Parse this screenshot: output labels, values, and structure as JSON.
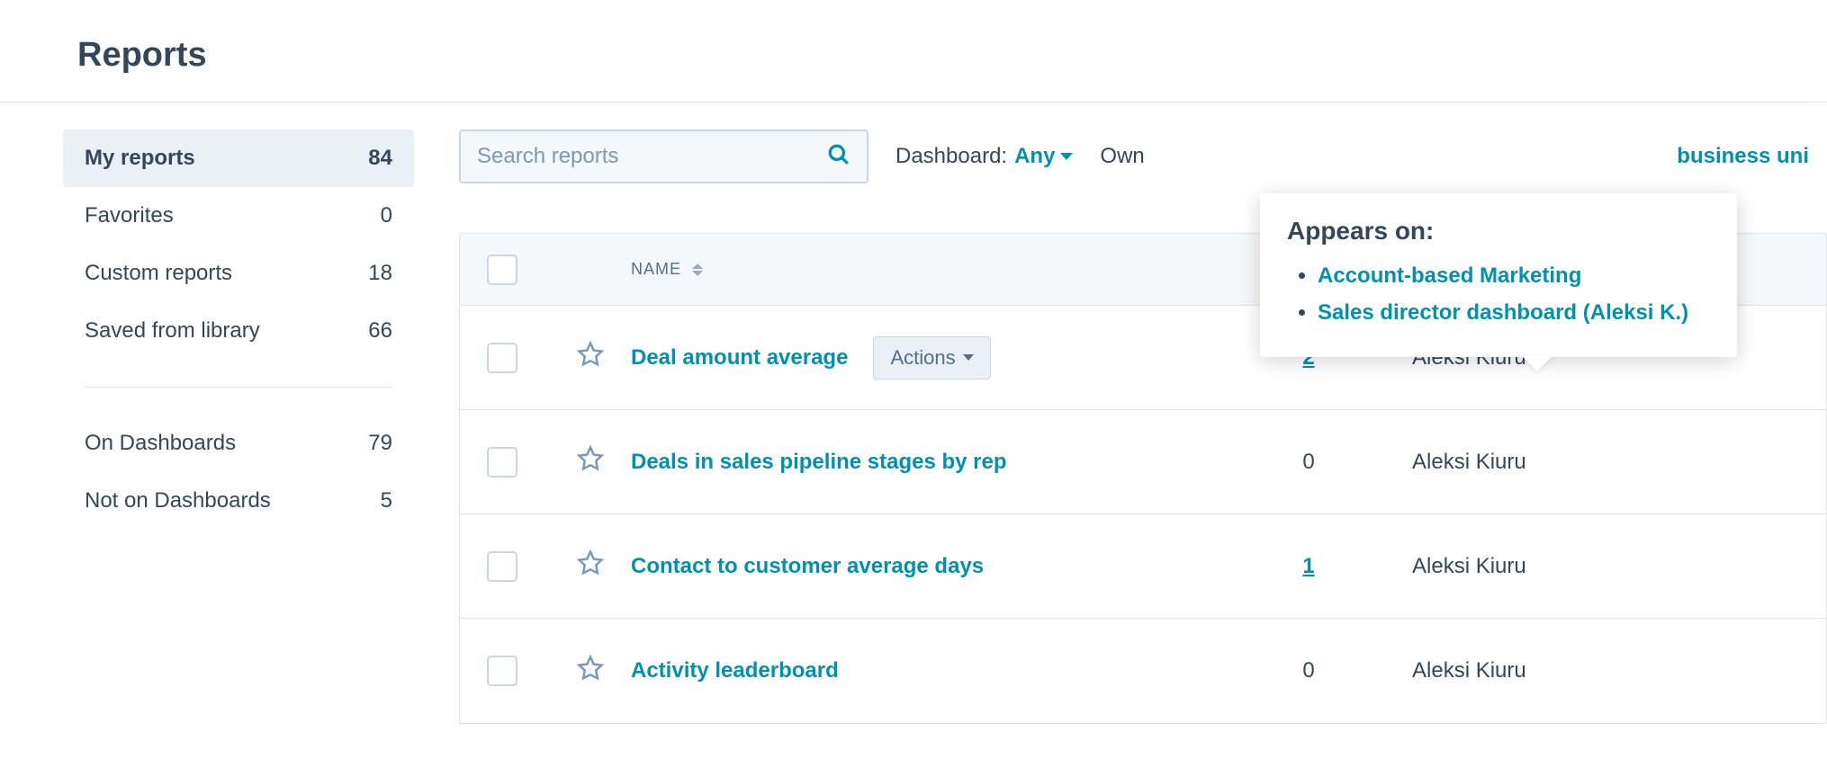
{
  "page": {
    "title": "Reports"
  },
  "sidebar": {
    "items": [
      {
        "label": "My reports",
        "count": "84",
        "active": true
      },
      {
        "label": "Favorites",
        "count": "0",
        "active": false
      },
      {
        "label": "Custom reports",
        "count": "18",
        "active": false
      },
      {
        "label": "Saved from library",
        "count": "66",
        "active": false
      }
    ],
    "secondary": [
      {
        "label": "On Dashboards",
        "count": "79"
      },
      {
        "label": "Not on Dashboards",
        "count": "5"
      }
    ]
  },
  "filters": {
    "search_placeholder": "Search reports",
    "dashboard_label": "Dashboard:",
    "dashboard_value": "Any",
    "owned_label_partial": "Own",
    "business_unit_partial": "business uni"
  },
  "table": {
    "columns": {
      "name": "NAME"
    },
    "rows": [
      {
        "name": "Deal amount average",
        "dashboards": "2",
        "dash_link": true,
        "owner": "Aleksi Kiuru",
        "show_actions": true
      },
      {
        "name": "Deals in sales pipeline stages by rep",
        "dashboards": "0",
        "dash_link": false,
        "owner": "Aleksi Kiuru",
        "show_actions": false
      },
      {
        "name": "Contact to customer average days",
        "dashboards": "1",
        "dash_link": true,
        "owner": "Aleksi Kiuru",
        "show_actions": false
      },
      {
        "name": "Activity leaderboard",
        "dashboards": "0",
        "dash_link": false,
        "owner": "Aleksi Kiuru",
        "show_actions": false
      }
    ],
    "actions_label": "Actions"
  },
  "popover": {
    "title": "Appears on:",
    "items": [
      "Account-based Marketing",
      "Sales director dashboard (Aleksi K.)"
    ]
  }
}
